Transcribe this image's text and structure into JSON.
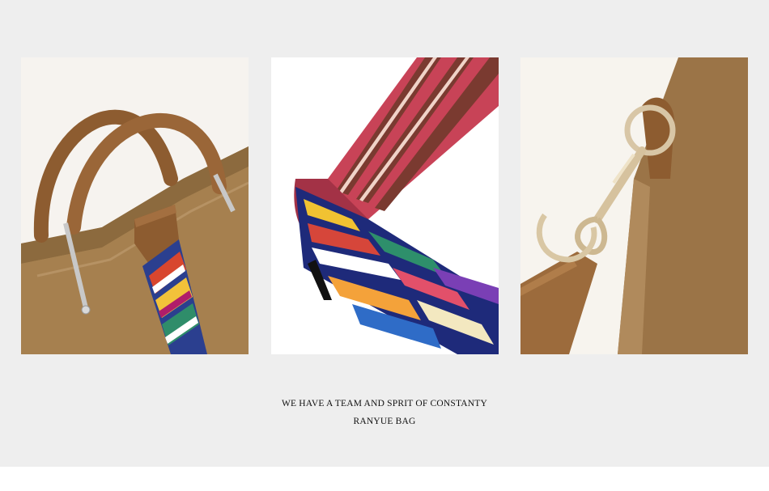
{
  "images": [
    {
      "subject": "handbag-handle-and-strap-closeup"
    },
    {
      "subject": "colorful-woven-shoulder-strap"
    },
    {
      "subject": "strap-clasp-hardware"
    }
  ],
  "caption": {
    "line1": "WE HAVE A TEAM AND SPRIT OF CONSTANTY",
    "line2": "RANYUE BAG"
  },
  "colors": {
    "background": "#eeeeee",
    "panel": "#ffffff",
    "suede": "#a07a4d",
    "leather": "#9c6b3c"
  }
}
